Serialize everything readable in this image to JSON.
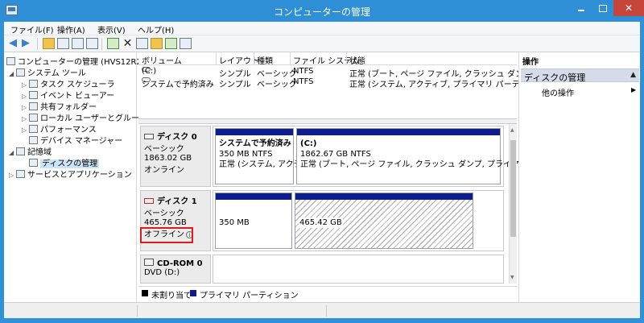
{
  "window": {
    "title": "コンピューターの管理"
  },
  "menu": [
    "ファイル(F)",
    "操作(A)",
    "表示(V)",
    "ヘルプ(H)"
  ],
  "tree": {
    "root": "コンピューターの管理 (HVS12R2)",
    "system_tools": "システム ツール",
    "task_scheduler": "タスク スケジューラ",
    "event_viewer": "イベント ビューアー",
    "shared_folders": "共有フォルダー",
    "local_users": "ローカル ユーザーとグループ",
    "performance": "パフォーマンス",
    "device_manager": "デバイス マネージャー",
    "storage": "記憶域",
    "disk_management": "ディスクの管理",
    "services_apps": "サービスとアプリケーション"
  },
  "volume_list": {
    "columns": [
      "ボリューム",
      "レイアウト",
      "種類",
      "ファイル システム",
      "状態"
    ],
    "rows": [
      {
        "volume": "(C:)",
        "layout": "シンプル",
        "type": "ベーシック",
        "fs": "NTFS",
        "status": "正常 (ブート, ページ ファイル, クラッシュ ダンプ, プライ"
      },
      {
        "volume": "システムで予約済み",
        "layout": "シンプル",
        "type": "ベーシック",
        "fs": "NTFS",
        "status": "正常 (システム, アクティブ, プライマリ パーティション)"
      }
    ]
  },
  "disks": {
    "disk0": {
      "name": "ディスク 0",
      "type": "ベーシック",
      "size": "1863.02 GB",
      "state": "オンライン",
      "part1": {
        "name": "システムで予約済み",
        "size": "350 MB NTFS",
        "status": "正常 (システム, アクティ"
      },
      "part2": {
        "name": "(C:)",
        "size": "1862.67 GB NTFS",
        "status": "正常 (ブート, ページ ファイル, クラッシュ ダンプ, プライマリ パーティ"
      }
    },
    "disk1": {
      "name": "ディスク 1",
      "type": "ベーシック",
      "size": "465.76 GB",
      "state": "オフライン",
      "info": "i",
      "part1": {
        "size": "350 MB"
      },
      "part2": {
        "size": "465.42 GB"
      }
    },
    "cdrom0": {
      "name": "CD-ROM 0",
      "drive": "DVD (D:)"
    }
  },
  "legend": {
    "unallocated": "未割り当て",
    "primary": "プライマリ パーティション"
  },
  "actions": {
    "title": "操作",
    "section": "ディスクの管理",
    "other": "他の操作"
  },
  "colors": {
    "titlebar": "#2e8fd6",
    "partition_bar": "#0f1c8c",
    "highlight": "#e01b1b"
  }
}
